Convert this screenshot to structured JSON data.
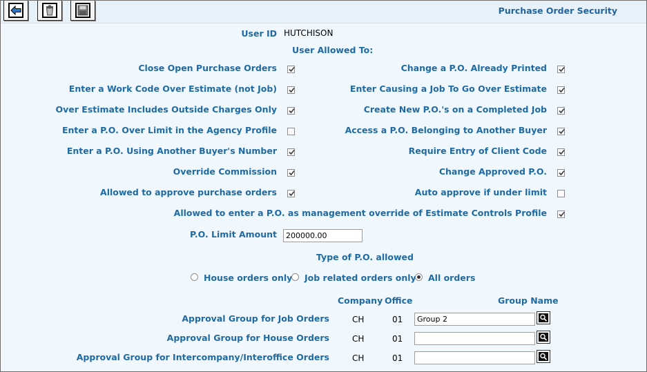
{
  "title": "Purchase Order Security",
  "toolbar": {
    "back_icon": "back-arrow-icon",
    "delete_icon": "trash-icon",
    "save_icon": "save-icon"
  },
  "user": {
    "id_label": "User ID",
    "id_value": "HUTCHISON",
    "allowed_label": "User Allowed To:"
  },
  "permissions_left": [
    {
      "label": "Close Open Purchase Orders",
      "checked": true
    },
    {
      "label": "Enter a Work Code Over Estimate (not Job)",
      "checked": true
    },
    {
      "label": "Over Estimate Includes Outside Charges Only",
      "checked": true
    },
    {
      "label": "Enter a P.O. Over Limit in the Agency Profile",
      "checked": false
    },
    {
      "label": "Enter a P.O. Using Another Buyer's Number",
      "checked": true
    },
    {
      "label": "Override Commission",
      "checked": true
    },
    {
      "label": "Allowed to approve purchase orders",
      "checked": true
    }
  ],
  "permissions_right": [
    {
      "label": "Change a P.O. Already Printed",
      "checked": true
    },
    {
      "label": "Enter Causing a Job To Go Over Estimate",
      "checked": true
    },
    {
      "label": "Create New P.O.'s on a Completed Job",
      "checked": true
    },
    {
      "label": "Access a P.O. Belonging to Another Buyer",
      "checked": true
    },
    {
      "label": "Require Entry of Client Code",
      "checked": true
    },
    {
      "label": "Change Approved P.O.",
      "checked": true
    },
    {
      "label": "Auto approve if under limit",
      "checked": false
    }
  ],
  "management_override": {
    "label": "Allowed to enter a P.O. as management override of Estimate Controls Profile",
    "checked": true
  },
  "po_limit": {
    "label": "P.O. Limit Amount",
    "value": "200000.00"
  },
  "po_type": {
    "label": "Type of P.O. allowed",
    "options": [
      {
        "label": "House orders only",
        "selected": false
      },
      {
        "label": "Job related orders only",
        "selected": false
      },
      {
        "label": "All orders",
        "selected": true
      }
    ]
  },
  "approval": {
    "headers": {
      "company": "Company",
      "office": "Office",
      "group": "Group Name"
    },
    "rows": [
      {
        "label": "Approval Group for Job Orders",
        "company": "CH",
        "office": "01",
        "group": "Group 2"
      },
      {
        "label": "Approval Group for House Orders",
        "company": "CH",
        "office": "01",
        "group": ""
      },
      {
        "label": "Approval Group for Intercompany/Interoffice Orders",
        "company": "CH",
        "office": "01",
        "group": ""
      }
    ]
  },
  "colors": {
    "label": "#1f6aa3",
    "background": "#f0f8fd",
    "toolbar": "#e6f1f9"
  }
}
